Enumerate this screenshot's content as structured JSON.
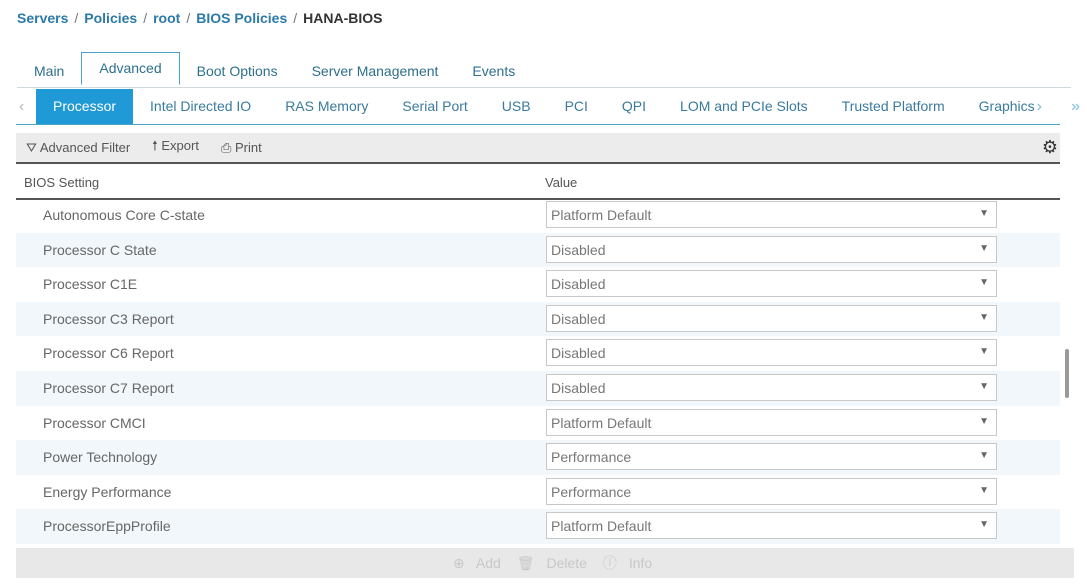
{
  "breadcrumb": [
    "Servers",
    "Policies",
    "root",
    "BIOS Policies",
    "HANA-BIOS"
  ],
  "tabs": [
    "Main",
    "Advanced",
    "Boot Options",
    "Server Management",
    "Events"
  ],
  "active_tab": "Advanced",
  "subtabs": [
    "Processor",
    "Intel Directed IO",
    "RAS Memory",
    "Serial Port",
    "USB",
    "PCI",
    "QPI",
    "LOM and PCIe Slots",
    "Trusted Platform",
    "Graphics"
  ],
  "toolbar": {
    "filter": "Advanced Filter",
    "export": "Export",
    "print": "Print"
  },
  "table": {
    "col1": "BIOS Setting",
    "col2": "Value",
    "rows": [
      {
        "name": "Autonomous Core C-state",
        "value": "Platform Default"
      },
      {
        "name": "Processor C State",
        "value": "Disabled"
      },
      {
        "name": "Processor C1E",
        "value": "Disabled"
      },
      {
        "name": "Processor C3 Report",
        "value": "Disabled"
      },
      {
        "name": "Processor C6 Report",
        "value": "Disabled"
      },
      {
        "name": "Processor C7 Report",
        "value": "Disabled"
      },
      {
        "name": "Processor CMCI",
        "value": "Platform Default"
      },
      {
        "name": "Power Technology",
        "value": "Performance"
      },
      {
        "name": "Energy Performance",
        "value": "Performance"
      },
      {
        "name": "ProcessorEppProfile",
        "value": "Platform Default"
      }
    ]
  },
  "footer": {
    "add": "Add",
    "delete": "Delete",
    "info": "Info"
  },
  "colors": {
    "accent": "#1f9ad6",
    "link": "#2b7aa8"
  }
}
